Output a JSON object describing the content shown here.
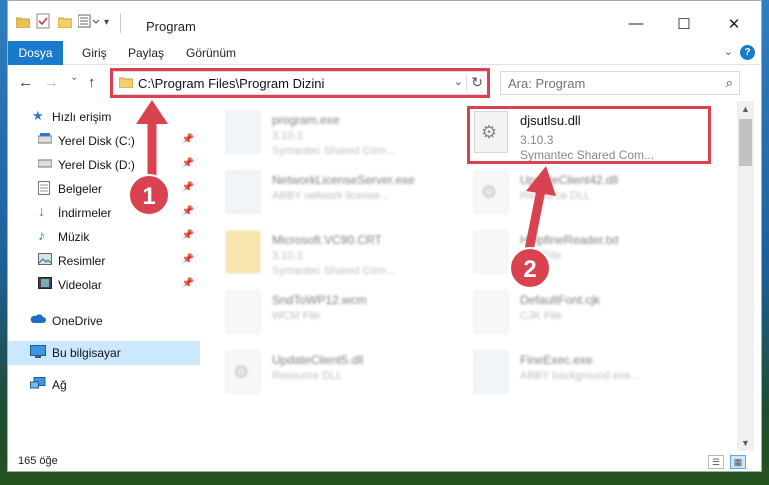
{
  "window": {
    "title": "Program",
    "controls": {
      "minimize": "—",
      "maximize": "☐",
      "close": "✕"
    }
  },
  "ribbon": {
    "tabs": [
      "Dosya",
      "Giriş",
      "Paylaş",
      "Görünüm"
    ],
    "collapse": "⌄",
    "help": "?"
  },
  "nav": {
    "back": "←",
    "forward": "→",
    "dropdown": "⌄",
    "up": "↑",
    "address": "C:\\Program Files\\Program Dizini",
    "address_dropdown": "⌄",
    "refresh": "↻",
    "search_placeholder": "Ara: Program",
    "search_icon": "⌕"
  },
  "sidebar": {
    "items": [
      {
        "label": "Hızlı erişim",
        "icon": "star-icon",
        "pinned": false,
        "selected": false
      },
      {
        "label": "Yerel Disk (C:)",
        "icon": "drive-icon",
        "pinned": true,
        "selected": false
      },
      {
        "label": "Yerel Disk (D:)",
        "icon": "drive-icon",
        "pinned": true,
        "selected": false
      },
      {
        "label": "Belgeler",
        "icon": "documents-icon",
        "pinned": true,
        "selected": false
      },
      {
        "label": "İndirmeler",
        "icon": "download-icon",
        "pinned": true,
        "selected": false
      },
      {
        "label": "Müzik",
        "icon": "music-icon",
        "pinned": true,
        "selected": false
      },
      {
        "label": "Resimler",
        "icon": "pictures-icon",
        "pinned": true,
        "selected": false
      },
      {
        "label": "Videolar",
        "icon": "videos-icon",
        "pinned": true,
        "selected": false
      },
      {
        "label": "OneDrive",
        "icon": "cloud-icon",
        "pinned": false,
        "selected": false
      },
      {
        "label": "Bu bilgisayar",
        "icon": "computer-icon",
        "pinned": false,
        "selected": true
      },
      {
        "label": "Ağ",
        "icon": "network-icon",
        "pinned": false,
        "selected": false
      }
    ],
    "pin_glyph": "📌"
  },
  "files": [
    {
      "name": "program.exe",
      "line2": "3.10.3",
      "line3": "Symantec Shared Com...",
      "icon": "exe-icon",
      "focused": false
    },
    {
      "name": "djsutlsu.dll",
      "line2": "3.10.3",
      "line3": "Symantec Shared Com...",
      "icon": "dll-gear-icon",
      "focused": true
    },
    {
      "name": "NetworkLicenseServer.exe",
      "line2": "ABBY network license...",
      "line3": "",
      "icon": "exe-icon",
      "focused": false
    },
    {
      "name": "UpdateClient42.dll",
      "line2": "Resource DLL",
      "line3": "",
      "icon": "dll-gear-icon",
      "focused": false
    },
    {
      "name": "Microsoft.VC90.CRT",
      "line2": "3.10.3",
      "line3": "Symantec Shared Com...",
      "icon": "folder-icon",
      "focused": false
    },
    {
      "name": "HelpfineReader.txt",
      "line2": "Text File",
      "line3": "",
      "icon": "file-icon",
      "focused": false
    },
    {
      "name": "SndToWP12.wcm",
      "line2": "WCM File",
      "line3": "",
      "icon": "file-icon",
      "focused": false
    },
    {
      "name": "DefaultFont.cjk",
      "line2": "CJK File",
      "line3": "",
      "icon": "file-icon",
      "focused": false
    },
    {
      "name": "UpdateClient5.dll",
      "line2": "Resource DLL",
      "line3": "",
      "icon": "dll-gear-icon",
      "focused": false
    },
    {
      "name": "FineExec.exe",
      "line2": "ABBY background exe...",
      "line3": "",
      "icon": "exe-icon",
      "focused": false
    }
  ],
  "scrollbar": {
    "up": "▲",
    "down": "▼"
  },
  "status": {
    "count": "165 öğe",
    "details_view": "☰",
    "tiles_view": "▦"
  },
  "annotations": {
    "step1": "1",
    "step2": "2",
    "color": "#d9434f"
  }
}
